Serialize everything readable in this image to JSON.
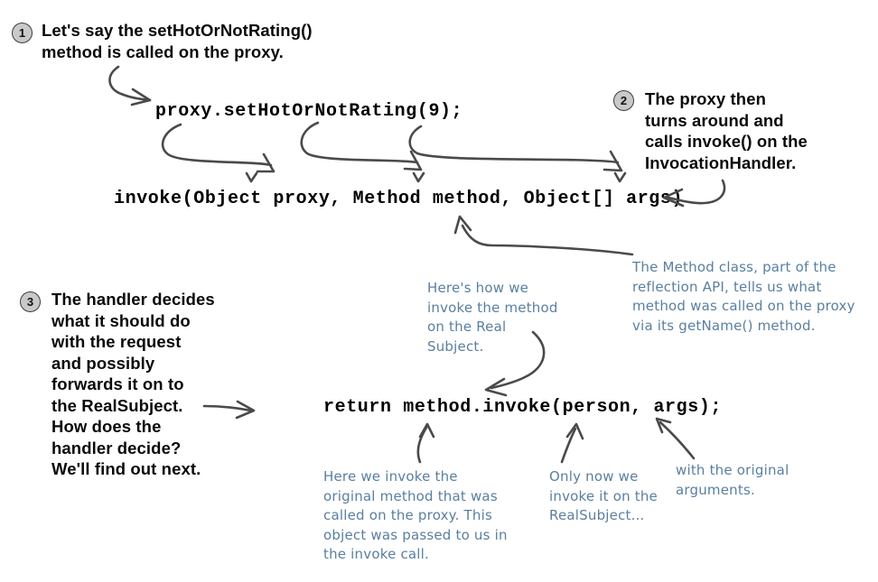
{
  "page": {
    "kind": "book-figure",
    "background_color": "#ffffff"
  },
  "colors": {
    "code_text": "#000000",
    "body_text": "#0a0a0a",
    "annotation_text": "#5a7fa0",
    "arrow": "#4a4a4a",
    "badge_fill": "#c9c9c9",
    "badge_border": "#3d3d3d"
  },
  "steps": [
    {
      "number": "1",
      "text": "Let's say the setHotOrNotRating()\nmethod is called on the proxy."
    },
    {
      "number": "2",
      "text": "The proxy then\nturns around and\ncalls invoke() on the\nInvocationHandler."
    },
    {
      "number": "3",
      "text": "The handler decides\nwhat it should do\nwith the request\nand possibly\nforwards it on to\nthe RealSubject.\nHow does the\nhandler decide?\nWe'll find out next."
    }
  ],
  "code_lines": {
    "proxy_call": "proxy.setHotOrNotRating(9);",
    "invoke_signature": "invoke(Object proxy, Method method, Object[] args)",
    "return_statement": "return method.invoke(person, args);"
  },
  "annotations": [
    {
      "id": "method-class-note",
      "text": "The Method class, part of the\nreflection API, tells us what\nmethod was called on the proxy\nvia its getName() method."
    },
    {
      "id": "invoke-on-real-subject-note",
      "text": "Here's how we\ninvoke the method\non the Real\nSubject."
    },
    {
      "id": "original-method-note",
      "text": "Here we invoke the\noriginal method that was\ncalled on the proxy.  This\nobject was passed to us in\nthe invoke call."
    },
    {
      "id": "real-subject-note",
      "text": "Only now we\ninvoke it on the\nRealSubject..."
    },
    {
      "id": "original-arguments-note",
      "text": "with the original\narguments."
    }
  ]
}
